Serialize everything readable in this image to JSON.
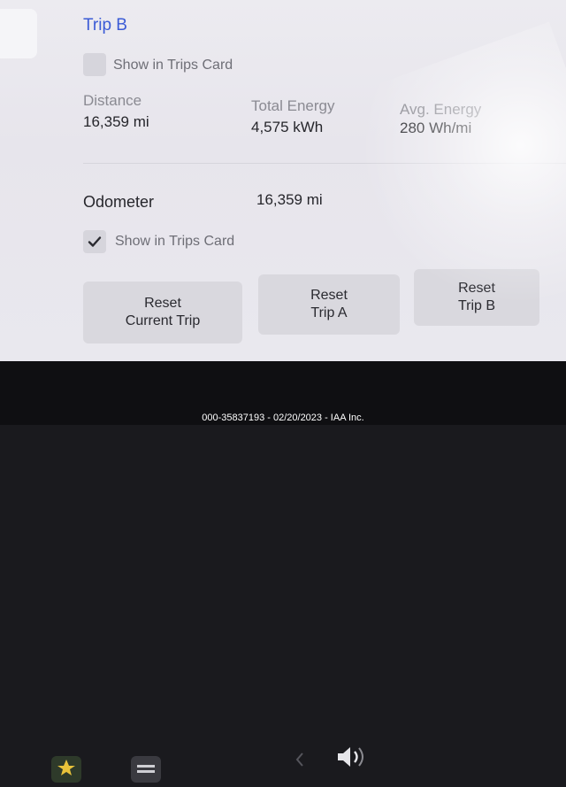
{
  "trip_b": {
    "title": "Trip B",
    "show_in_trips_card": "Show in Trips Card",
    "show_checked": false,
    "distance_label": "Distance",
    "distance_value": "16,359  mi",
    "energy_label": "Total Energy",
    "energy_value": "4,575  kWh",
    "avg_label": "Avg. Energy",
    "avg_value": "280  Wh/mi"
  },
  "odometer": {
    "label": "Odometer",
    "value": "16,359  mi",
    "show_in_trips_card": "Show in Trips Card",
    "show_checked": true
  },
  "buttons": {
    "reset_current_line1": "Reset",
    "reset_current_line2": "Current Trip",
    "reset_a_line1": "Reset",
    "reset_a_line2": "Trip A",
    "reset_b_line1": "Reset",
    "reset_b_line2": "Trip B"
  },
  "taskbar": {
    "icons": [
      "games-icon",
      "menu-icon",
      "chevron-left-icon",
      "volume-icon"
    ]
  },
  "caption": "000-35837193 - 02/20/2023 - IAA Inc.",
  "colors": {
    "accent": "#3b5bd6",
    "background": "#ecebf0",
    "button": "#d9d8de"
  }
}
